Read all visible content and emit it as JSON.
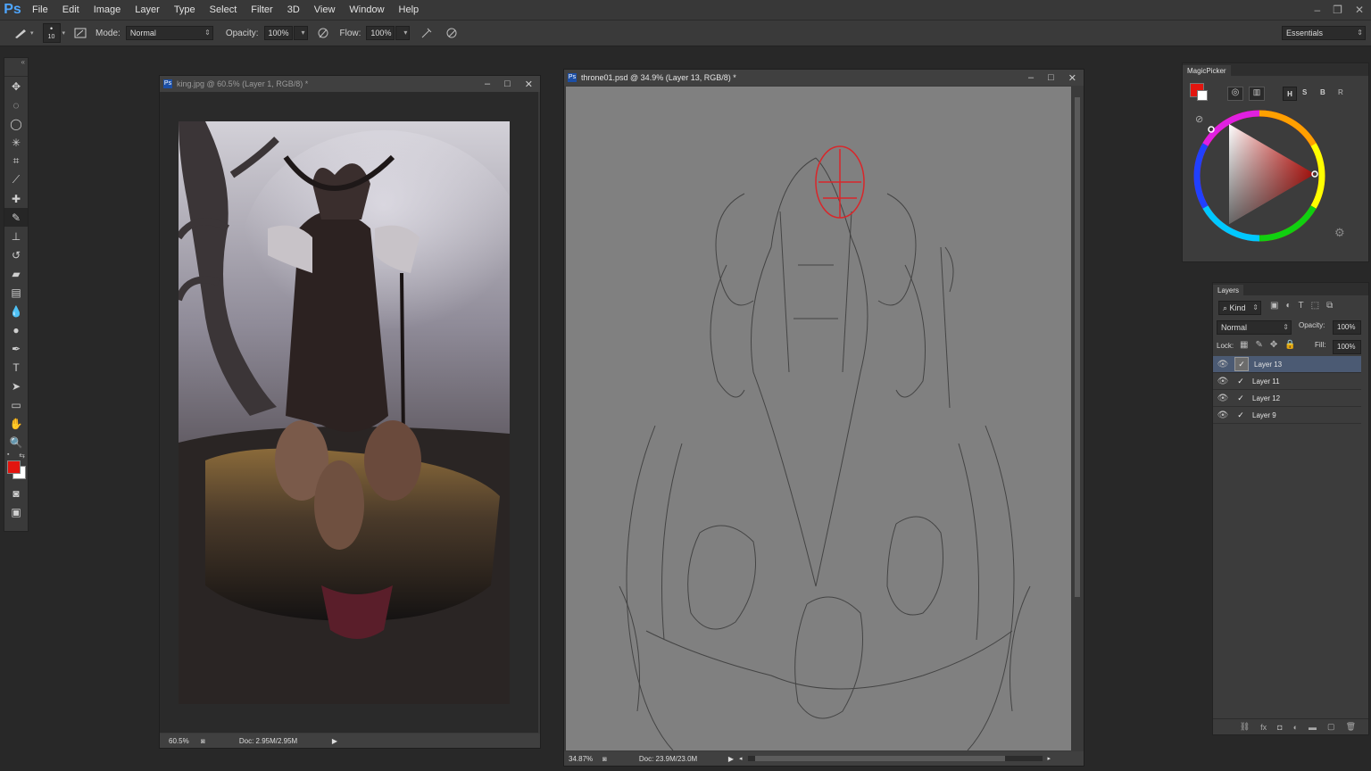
{
  "app": {
    "logo": "Ps"
  },
  "menu": [
    "File",
    "Edit",
    "Image",
    "Layer",
    "Type",
    "Select",
    "Filter",
    "3D",
    "View",
    "Window",
    "Help"
  ],
  "options": {
    "brush_size": "10",
    "mode_label": "Mode:",
    "mode_value": "Normal",
    "opacity_label": "Opacity:",
    "opacity_value": "100%",
    "flow_label": "Flow:",
    "flow_value": "100%",
    "workspace": "Essentials"
  },
  "doc1": {
    "title": "king.jpg @ 60.5% (Layer 1, RGB/8) *",
    "zoom": "60.5%",
    "doc_size": "Doc: 2.95M/2.95M"
  },
  "doc2": {
    "title": "throne01.psd @ 34.9% (Layer 13, RGB/8) *",
    "zoom": "34.87%",
    "doc_size": "Doc: 23.9M/23.0M"
  },
  "colors": {
    "foreground": "#e3150f",
    "background": "#ffffff",
    "sketch_red": "#d9262a",
    "accent": "#4b5a73"
  },
  "magicpicker": {
    "title": "MagicPicker",
    "modes": [
      "H",
      "S",
      "B",
      "R"
    ]
  },
  "layers_panel": {
    "title": "Layers",
    "kind": "Kind",
    "blend": "Normal",
    "opacity_label": "Opacity:",
    "opacity_value": "100%",
    "lock_label": "Lock:",
    "fill_label": "Fill:",
    "fill_value": "100%",
    "layers": [
      {
        "name": "Layer 13",
        "selected": true
      },
      {
        "name": "Layer 11",
        "selected": false
      },
      {
        "name": "Layer 12",
        "selected": false
      },
      {
        "name": "Layer 9",
        "selected": false
      }
    ]
  }
}
